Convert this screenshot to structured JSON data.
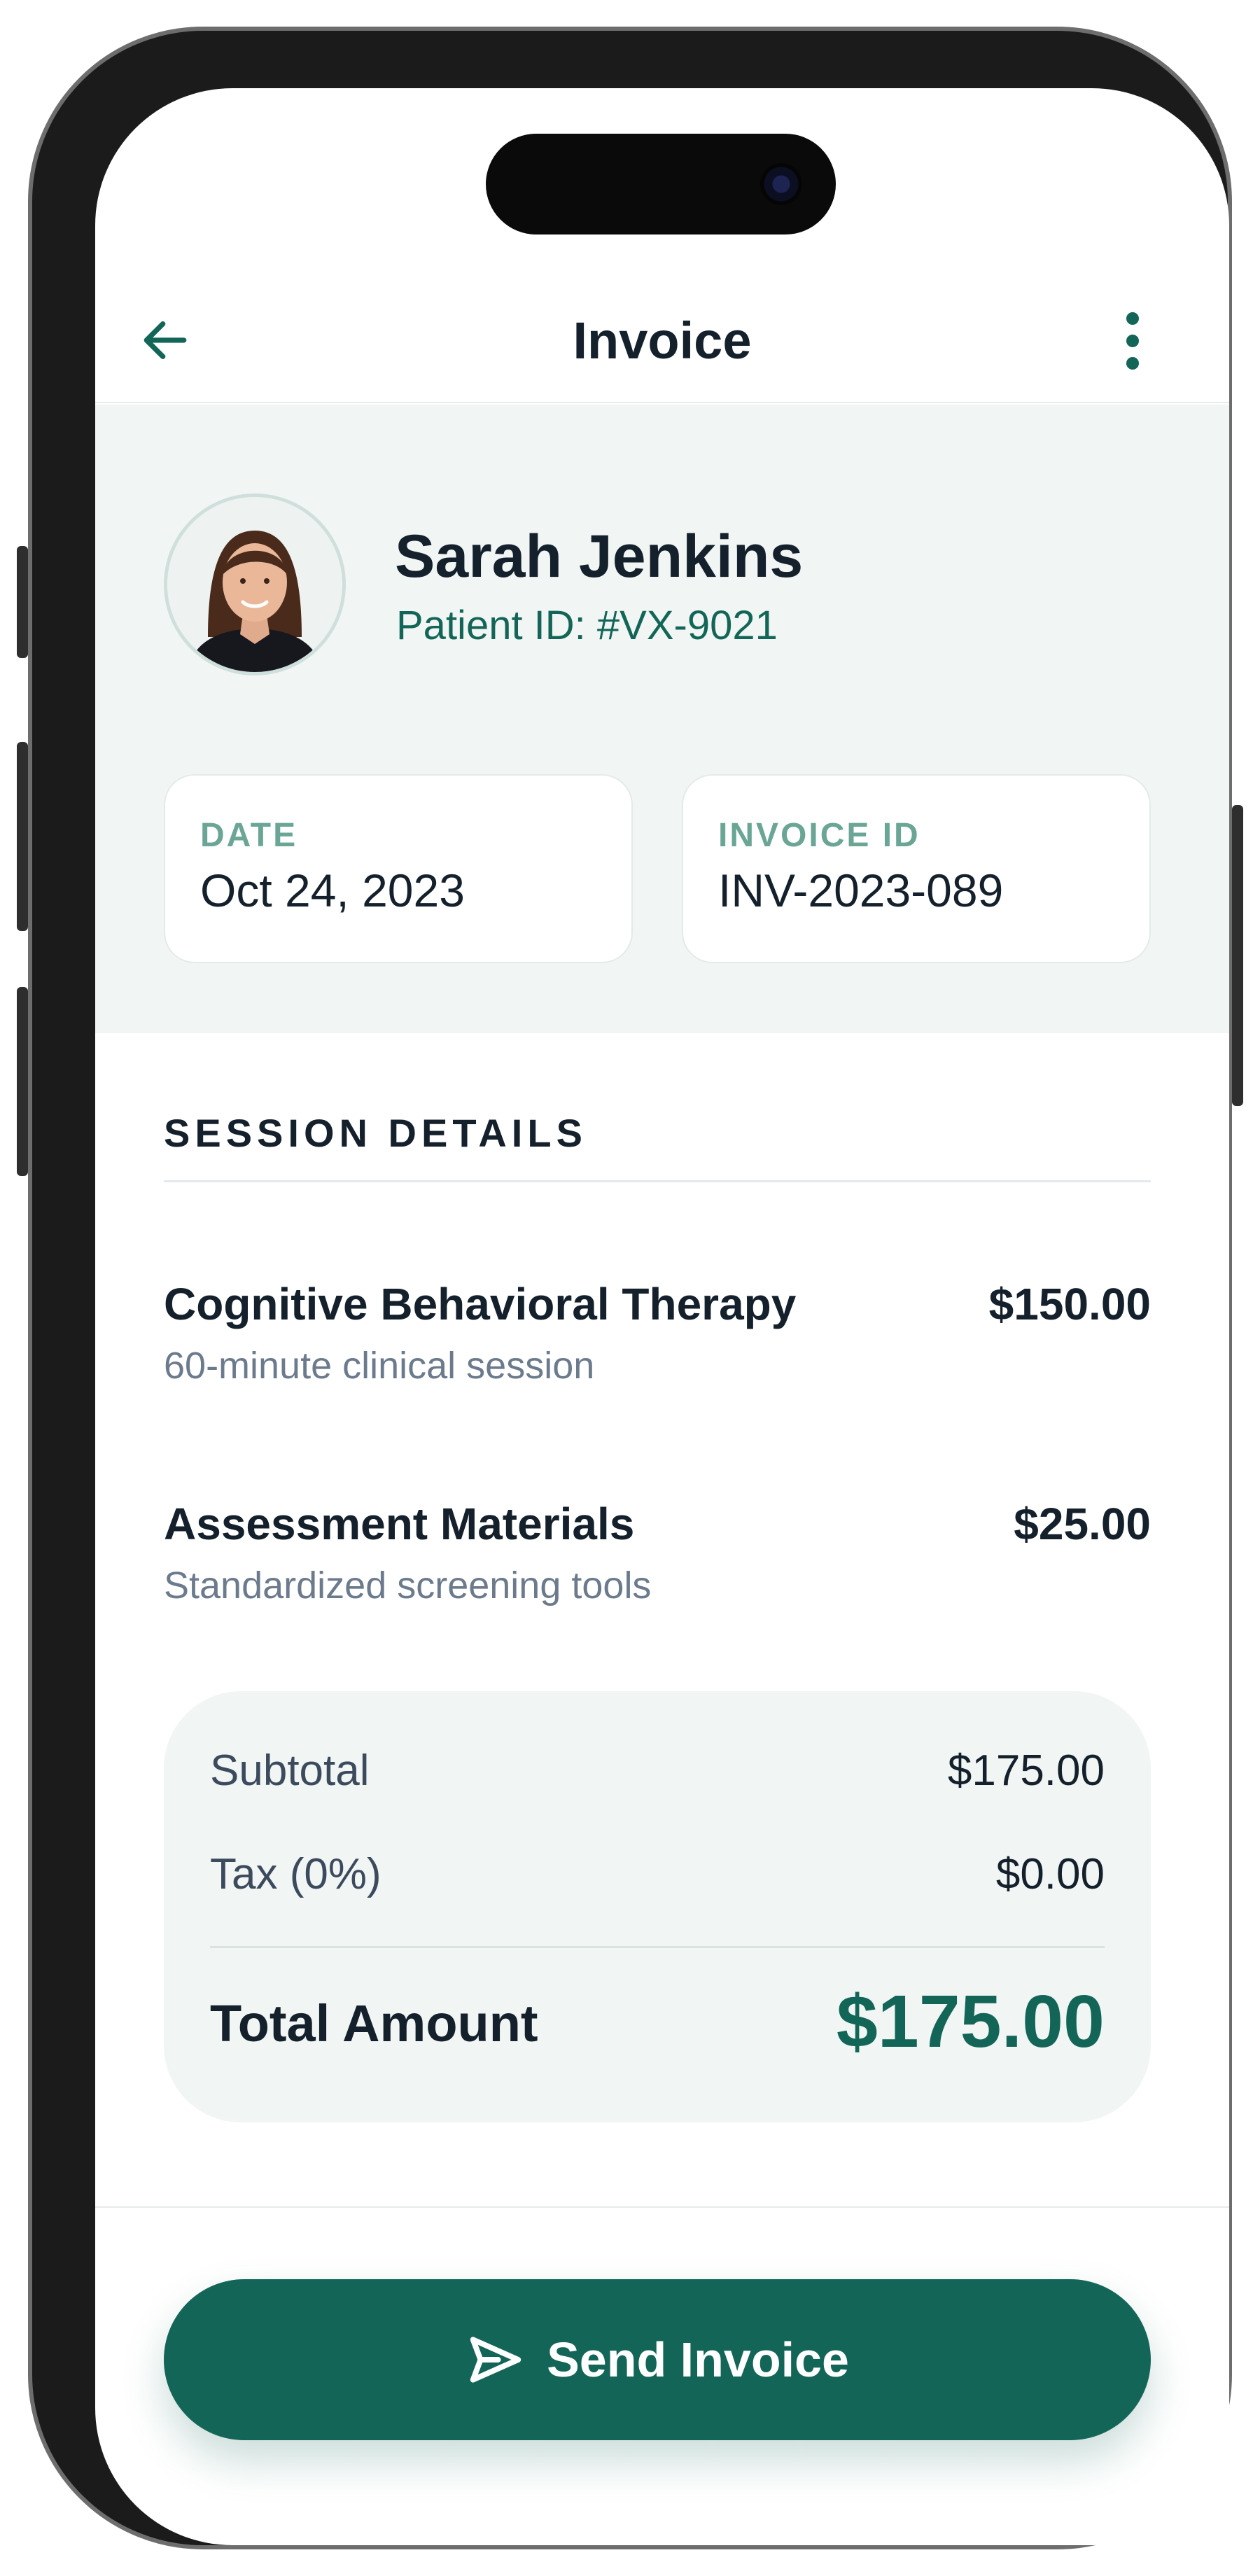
{
  "colors": {
    "accent": "#136657",
    "label_accent": "#6aa596",
    "text_dark": "#14202b",
    "text_muted": "#6b7a8c",
    "panel_bg": "#f1f5f4"
  },
  "header": {
    "title": "Invoice",
    "back_icon": "arrow-left-icon",
    "menu_icon": "more-vertical-icon"
  },
  "patient": {
    "name": "Sarah Jenkins",
    "patient_id": "Patient ID: #VX-9021",
    "avatar_icon": "avatar-photo"
  },
  "info_cards": [
    {
      "label": "DATE",
      "value": "Oct 24, 2023"
    },
    {
      "label": "INVOICE ID",
      "value": "INV-2023-089"
    }
  ],
  "session": {
    "title": "SESSION DETAILS",
    "items": [
      {
        "name": "Cognitive Behavioral Therapy",
        "description": "60-minute clinical session",
        "price": "$150.00"
      },
      {
        "name": "Assessment Materials",
        "description": "Standardized screening tools",
        "price": "$25.00"
      }
    ]
  },
  "totals": {
    "subtotal_label": "Subtotal",
    "subtotal_value": "$175.00",
    "tax_label": "Tax (0%)",
    "tax_value": "$0.00",
    "total_label": "Total Amount",
    "total_value": "$175.00"
  },
  "actions": {
    "send_label": "Send Invoice",
    "send_icon": "send-icon"
  }
}
